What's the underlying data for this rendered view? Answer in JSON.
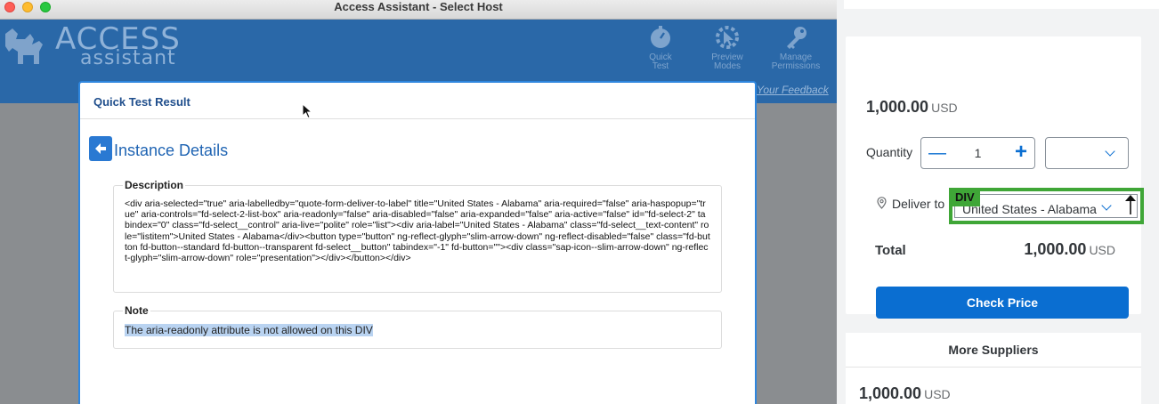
{
  "window": {
    "title": "Access Assistant - Select Host"
  },
  "app_header": {
    "logo_line1": "ACCESS",
    "logo_line2": "assistant",
    "buttons": [
      {
        "label_line1": "Quick",
        "label_line2": "Test",
        "icon": "stopwatch-icon"
      },
      {
        "label_line1": "Preview",
        "label_line2": "Modes",
        "icon": "cursor-gear-icon"
      },
      {
        "label_line1": "Manage",
        "label_line2": "Permissions",
        "icon": "key-icon"
      }
    ],
    "feedback_link": "Your Feedback"
  },
  "dialog": {
    "title": "Quick Test Result",
    "section_title": "Instance Details",
    "description_legend": "Description",
    "description_text": "<div aria-selected=\"true\" aria-labelledby=\"quote-form-deliver-to-label\" title=\"United States - Alabama\" aria-required=\"false\" aria-haspopup=\"true\" aria-controls=\"fd-select-2-list-box\" aria-readonly=\"false\" aria-disabled=\"false\" aria-expanded=\"false\" aria-active=\"false\" id=\"fd-select-2\" tabindex=\"0\" class=\"fd-select__control\" aria-live=\"polite\" role=\"list\"><div aria-label=\"United States - Alabama\" class=\"fd-select__text-content\" role=\"listitem\">United States - Alabama</div><button type=\"button\" ng-reflect-glyph=\"slim-arrow-down\" ng-reflect-disabled=\"false\" class=\"fd-button fd-button--standard fd-button--transparent fd-select__button\" tabindex=\"-1\" fd-button=\"\"><div class=\"sap-icon--slim-arrow-down\" ng-reflect-glyph=\"slim-arrow-down\" role=\"presentation\"></div></button></div>",
    "note_legend": "Note",
    "note_text": "The aria-readonly attribute is not allowed on this DIV"
  },
  "product": {
    "price": "1,000.00",
    "currency": "USD",
    "quantity_label": "Quantity",
    "quantity_value": "1",
    "deliver_label": "Deliver to",
    "deliver_value": "United States - Alabama",
    "highlight_tag": "DIV",
    "total_label": "Total",
    "total_value": "1,000.00",
    "total_currency": "USD",
    "check_price_label": "Check Price",
    "colors": {
      "accent": "#0a6ed1",
      "highlight": "#3fa637"
    }
  },
  "suppliers": {
    "title": "More Suppliers",
    "price": "1,000.00",
    "currency": "USD"
  }
}
